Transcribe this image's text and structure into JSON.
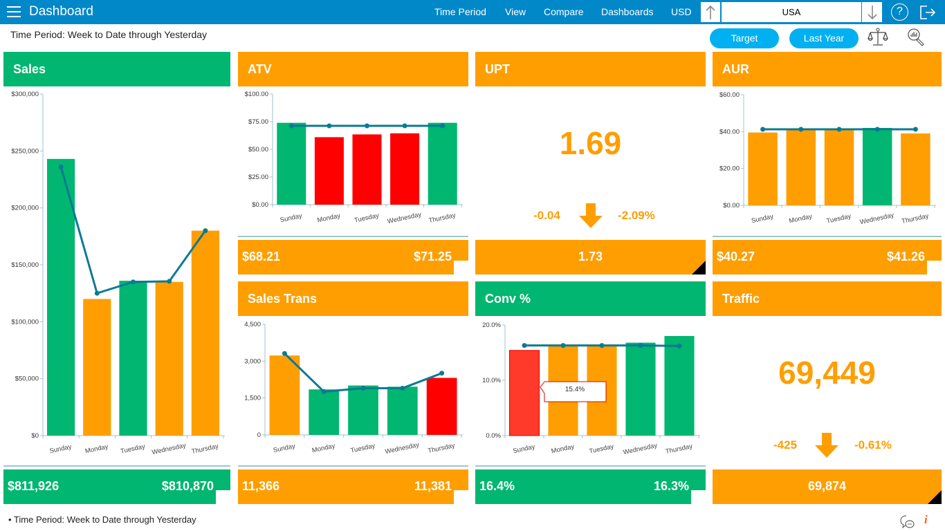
{
  "header": {
    "title": "Dashboard",
    "nav": [
      "Time Period",
      "View",
      "Compare",
      "Dashboards",
      "USD"
    ],
    "store_value": "USA"
  },
  "subheader": {
    "period_text": "Time Period: Week to Date through Yesterday",
    "target_label": "Target",
    "last_year_label": "Last Year"
  },
  "colors": {
    "green": "#00b670",
    "orange": "#ff9e00",
    "red": "#ff0000",
    "line": "#0b7a94",
    "topbar": "#0088c8",
    "pill": "#00b0f0"
  },
  "tiles": {
    "sales": {
      "title": "Sales",
      "actual": "$811,926",
      "compare": "$810,870"
    },
    "atv": {
      "title": "ATV",
      "actual": "$68.21",
      "compare": "$71.25"
    },
    "upt": {
      "title": "UPT",
      "value": "1.69",
      "delta": "-0.04",
      "delta_pct": "-2.09%",
      "compare": "1.73"
    },
    "aur": {
      "title": "AUR",
      "actual": "$40.27",
      "compare": "$41.26"
    },
    "sales_trans": {
      "title": "Sales Trans",
      "actual": "11,366",
      "compare": "11,381"
    },
    "conv": {
      "title": "Conv %",
      "actual": "16.4%",
      "compare": "16.3%",
      "tooltip": "15.4%"
    },
    "traffic": {
      "title": "Traffic",
      "value": "69,449",
      "delta": "-425",
      "delta_pct": "-0.61%",
      "compare": "69,874"
    }
  },
  "chart_data": [
    {
      "id": "sales",
      "type": "bar",
      "title": "Sales",
      "categories": [
        "Sunday",
        "Monday",
        "Tuesday",
        "Wednesday",
        "Thursday"
      ],
      "series": [
        {
          "name": "Actual",
          "type": "bar",
          "values": [
            243000,
            120000,
            136000,
            135000,
            180000
          ],
          "colors": [
            "green",
            "orange",
            "green",
            "orange",
            "orange"
          ]
        },
        {
          "name": "Compare",
          "type": "line",
          "values": [
            236000,
            125000,
            135000,
            135500,
            180000
          ]
        }
      ],
      "yticks": [
        "$0",
        "$50,000",
        "$100,000",
        "$150,000",
        "$200,000",
        "$250,000",
        "$300,000"
      ],
      "ylim": [
        0,
        300000
      ]
    },
    {
      "id": "atv",
      "type": "bar",
      "title": "ATV",
      "categories": [
        "Sunday",
        "Monday",
        "Tuesday",
        "Wednesday",
        "Thursday"
      ],
      "series": [
        {
          "name": "Actual",
          "type": "bar",
          "values": [
            74,
            61,
            63.5,
            64.5,
            74
          ],
          "colors": [
            "green",
            "red",
            "red",
            "red",
            "green"
          ]
        },
        {
          "name": "Compare",
          "type": "line",
          "values": [
            71.25,
            71.25,
            71.25,
            71.25,
            71.25
          ]
        }
      ],
      "yticks": [
        "$0.00",
        "$25.00",
        "$50.00",
        "$75.00",
        "$100.00"
      ],
      "ylim": [
        0,
        100
      ]
    },
    {
      "id": "aur",
      "type": "bar",
      "title": "AUR",
      "categories": [
        "Sunday",
        "Monday",
        "Tuesday",
        "Wednesday",
        "Thursday"
      ],
      "series": [
        {
          "name": "Actual",
          "type": "bar",
          "values": [
            39.5,
            41,
            41,
            42,
            39
          ],
          "colors": [
            "orange",
            "orange",
            "orange",
            "green",
            "orange"
          ]
        },
        {
          "name": "Compare",
          "type": "line",
          "values": [
            41.26,
            41.26,
            41.26,
            41.26,
            41.26
          ]
        }
      ],
      "yticks": [
        "$0.00",
        "$20.00",
        "$40.00",
        "$60.00"
      ],
      "ylim": [
        0,
        60
      ]
    },
    {
      "id": "sales_trans",
      "type": "bar",
      "title": "Sales Trans",
      "categories": [
        "Sunday",
        "Monday",
        "Tuesday",
        "Wednesday",
        "Thursday"
      ],
      "series": [
        {
          "name": "Actual",
          "type": "bar",
          "values": [
            3230,
            1850,
            2010,
            1960,
            2320
          ],
          "colors": [
            "orange",
            "green",
            "green",
            "green",
            "red"
          ]
        },
        {
          "name": "Compare",
          "type": "line",
          "values": [
            3310,
            1760,
            1900,
            1900,
            2510
          ]
        }
      ],
      "yticks": [
        "0",
        "1,500",
        "3,000",
        "4,500"
      ],
      "ylim": [
        0,
        4500
      ]
    },
    {
      "id": "conv",
      "type": "bar",
      "title": "Conv %",
      "categories": [
        "Sunday",
        "Monday",
        "Tuesday",
        "Wednesday",
        "Thursday"
      ],
      "series": [
        {
          "name": "Actual",
          "type": "bar",
          "values": [
            15.4,
            16.2,
            16.2,
            16.8,
            18.0
          ],
          "colors": [
            "redlight",
            "orange",
            "orange",
            "green",
            "green"
          ]
        },
        {
          "name": "Compare",
          "type": "line",
          "values": [
            16.3,
            16.3,
            16.3,
            16.3,
            16.2
          ]
        }
      ],
      "yticks": [
        "0.0%",
        "10.0%",
        "20.0%"
      ],
      "ylim": [
        0,
        20
      ]
    }
  ],
  "footer": {
    "note": "• Time Period: Week to Date through Yesterday"
  }
}
